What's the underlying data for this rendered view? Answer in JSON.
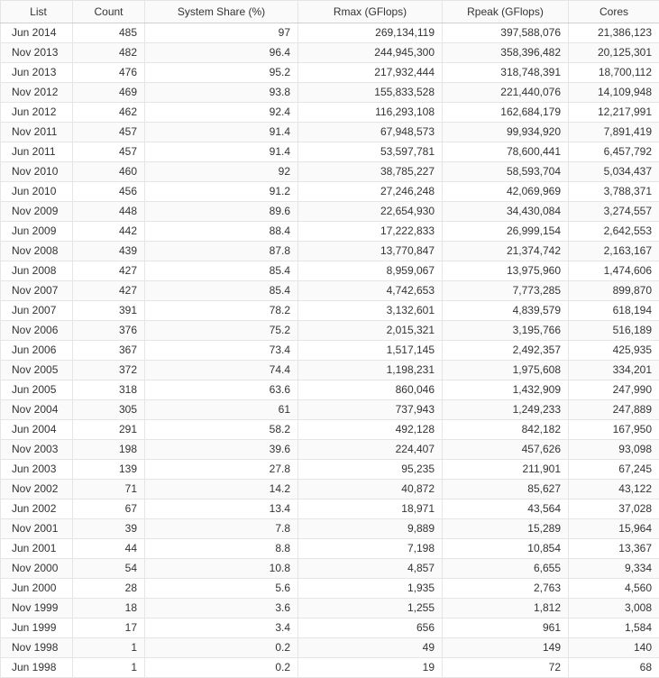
{
  "columns": {
    "list": "List",
    "count": "Count",
    "share": "System Share (%)",
    "rmax": "Rmax (GFlops)",
    "rpeak": "Rpeak (GFlops)",
    "cores": "Cores"
  },
  "rows": [
    {
      "list": "Jun 2014",
      "count": "485",
      "share": "97",
      "rmax": "269,134,119",
      "rpeak": "397,588,076",
      "cores": "21,386,123"
    },
    {
      "list": "Nov 2013",
      "count": "482",
      "share": "96.4",
      "rmax": "244,945,300",
      "rpeak": "358,396,482",
      "cores": "20,125,301"
    },
    {
      "list": "Jun 2013",
      "count": "476",
      "share": "95.2",
      "rmax": "217,932,444",
      "rpeak": "318,748,391",
      "cores": "18,700,112"
    },
    {
      "list": "Nov 2012",
      "count": "469",
      "share": "93.8",
      "rmax": "155,833,528",
      "rpeak": "221,440,076",
      "cores": "14,109,948"
    },
    {
      "list": "Jun 2012",
      "count": "462",
      "share": "92.4",
      "rmax": "116,293,108",
      "rpeak": "162,684,179",
      "cores": "12,217,991"
    },
    {
      "list": "Nov 2011",
      "count": "457",
      "share": "91.4",
      "rmax": "67,948,573",
      "rpeak": "99,934,920",
      "cores": "7,891,419"
    },
    {
      "list": "Jun 2011",
      "count": "457",
      "share": "91.4",
      "rmax": "53,597,781",
      "rpeak": "78,600,441",
      "cores": "6,457,792"
    },
    {
      "list": "Nov 2010",
      "count": "460",
      "share": "92",
      "rmax": "38,785,227",
      "rpeak": "58,593,704",
      "cores": "5,034,437"
    },
    {
      "list": "Jun 2010",
      "count": "456",
      "share": "91.2",
      "rmax": "27,246,248",
      "rpeak": "42,069,969",
      "cores": "3,788,371"
    },
    {
      "list": "Nov 2009",
      "count": "448",
      "share": "89.6",
      "rmax": "22,654,930",
      "rpeak": "34,430,084",
      "cores": "3,274,557"
    },
    {
      "list": "Jun 2009",
      "count": "442",
      "share": "88.4",
      "rmax": "17,222,833",
      "rpeak": "26,999,154",
      "cores": "2,642,553"
    },
    {
      "list": "Nov 2008",
      "count": "439",
      "share": "87.8",
      "rmax": "13,770,847",
      "rpeak": "21,374,742",
      "cores": "2,163,167"
    },
    {
      "list": "Jun 2008",
      "count": "427",
      "share": "85.4",
      "rmax": "8,959,067",
      "rpeak": "13,975,960",
      "cores": "1,474,606"
    },
    {
      "list": "Nov 2007",
      "count": "427",
      "share": "85.4",
      "rmax": "4,742,653",
      "rpeak": "7,773,285",
      "cores": "899,870"
    },
    {
      "list": "Jun 2007",
      "count": "391",
      "share": "78.2",
      "rmax": "3,132,601",
      "rpeak": "4,839,579",
      "cores": "618,194"
    },
    {
      "list": "Nov 2006",
      "count": "376",
      "share": "75.2",
      "rmax": "2,015,321",
      "rpeak": "3,195,766",
      "cores": "516,189"
    },
    {
      "list": "Jun 2006",
      "count": "367",
      "share": "73.4",
      "rmax": "1,517,145",
      "rpeak": "2,492,357",
      "cores": "425,935"
    },
    {
      "list": "Nov 2005",
      "count": "372",
      "share": "74.4",
      "rmax": "1,198,231",
      "rpeak": "1,975,608",
      "cores": "334,201"
    },
    {
      "list": "Jun 2005",
      "count": "318",
      "share": "63.6",
      "rmax": "860,046",
      "rpeak": "1,432,909",
      "cores": "247,990"
    },
    {
      "list": "Nov 2004",
      "count": "305",
      "share": "61",
      "rmax": "737,943",
      "rpeak": "1,249,233",
      "cores": "247,889"
    },
    {
      "list": "Jun 2004",
      "count": "291",
      "share": "58.2",
      "rmax": "492,128",
      "rpeak": "842,182",
      "cores": "167,950"
    },
    {
      "list": "Nov 2003",
      "count": "198",
      "share": "39.6",
      "rmax": "224,407",
      "rpeak": "457,626",
      "cores": "93,098"
    },
    {
      "list": "Jun 2003",
      "count": "139",
      "share": "27.8",
      "rmax": "95,235",
      "rpeak": "211,901",
      "cores": "67,245"
    },
    {
      "list": "Nov 2002",
      "count": "71",
      "share": "14.2",
      "rmax": "40,872",
      "rpeak": "85,627",
      "cores": "43,122"
    },
    {
      "list": "Jun 2002",
      "count": "67",
      "share": "13.4",
      "rmax": "18,971",
      "rpeak": "43,564",
      "cores": "37,028"
    },
    {
      "list": "Nov 2001",
      "count": "39",
      "share": "7.8",
      "rmax": "9,889",
      "rpeak": "15,289",
      "cores": "15,964"
    },
    {
      "list": "Jun 2001",
      "count": "44",
      "share": "8.8",
      "rmax": "7,198",
      "rpeak": "10,854",
      "cores": "13,367"
    },
    {
      "list": "Nov 2000",
      "count": "54",
      "share": "10.8",
      "rmax": "4,857",
      "rpeak": "6,655",
      "cores": "9,334"
    },
    {
      "list": "Jun 2000",
      "count": "28",
      "share": "5.6",
      "rmax": "1,935",
      "rpeak": "2,763",
      "cores": "4,560"
    },
    {
      "list": "Nov 1999",
      "count": "18",
      "share": "3.6",
      "rmax": "1,255",
      "rpeak": "1,812",
      "cores": "3,008"
    },
    {
      "list": "Jun 1999",
      "count": "17",
      "share": "3.4",
      "rmax": "656",
      "rpeak": "961",
      "cores": "1,584"
    },
    {
      "list": "Nov 1998",
      "count": "1",
      "share": "0.2",
      "rmax": "49",
      "rpeak": "149",
      "cores": "140"
    },
    {
      "list": "Jun 1998",
      "count": "1",
      "share": "0.2",
      "rmax": "19",
      "rpeak": "72",
      "cores": "68"
    }
  ]
}
